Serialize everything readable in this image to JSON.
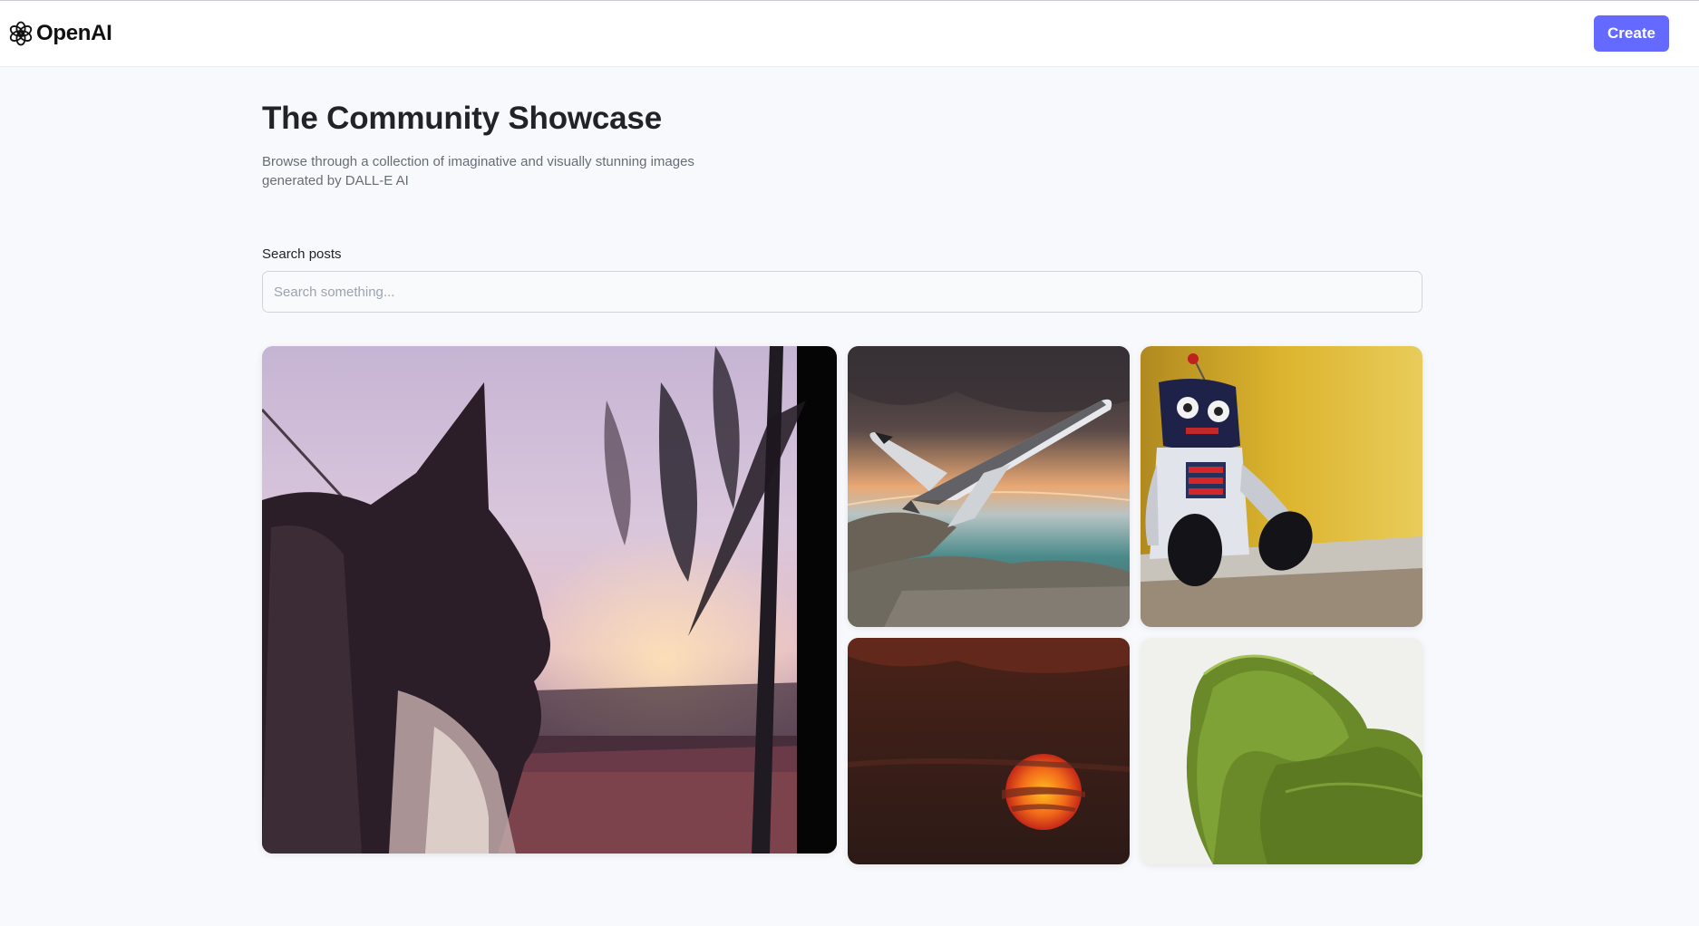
{
  "header": {
    "logo_text": "OpenAI",
    "logo_icon": "openai-knot-icon",
    "create_label": "Create"
  },
  "main": {
    "title": "The Community Showcase",
    "subtitle": "Browse through a collection of imaginative and visually stunning images generated by DALL-E AI",
    "search": {
      "label": "Search posts",
      "placeholder": "Search something...",
      "value": ""
    }
  },
  "gallery": {
    "items": [
      {
        "subject": "cat-silhouette-at-sunset"
      },
      {
        "subject": "space-shuttle-over-coast"
      },
      {
        "subject": "plush-robot-toy"
      },
      {
        "subject": "red-sun-sunset"
      },
      {
        "subject": "green-armchair"
      }
    ]
  },
  "colors": {
    "accent": "#6469ff",
    "page_bg": "#f8f9fc",
    "text": "#222328",
    "muted": "#666e75"
  }
}
